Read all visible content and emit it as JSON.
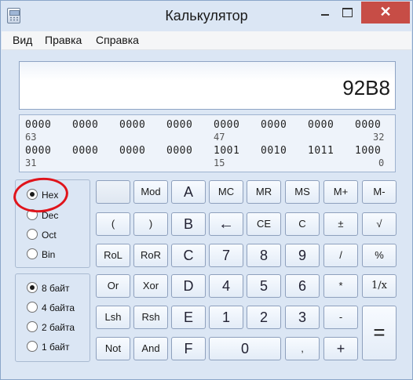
{
  "window": {
    "title": "Калькулятор",
    "close_label": "✕"
  },
  "menu": [
    "Вид",
    "Правка",
    "Справка"
  ],
  "display": {
    "value": "92B8"
  },
  "bits": {
    "row1": [
      "0000",
      "0000",
      "0000",
      "0000",
      "0000",
      "0000",
      "0000",
      "0000"
    ],
    "row1_positions": [
      "63",
      "47",
      "32"
    ],
    "row2": [
      "0000",
      "0000",
      "0000",
      "0000",
      "1001",
      "0010",
      "1011",
      "1000"
    ],
    "row2_positions": [
      "31",
      "15",
      "0"
    ]
  },
  "base_options": [
    {
      "label": "Hex",
      "selected": true
    },
    {
      "label": "Dec",
      "selected": false
    },
    {
      "label": "Oct",
      "selected": false
    },
    {
      "label": "Bin",
      "selected": false
    }
  ],
  "word_options": [
    {
      "label": "8 байт",
      "selected": true
    },
    {
      "label": "4 байта",
      "selected": false
    },
    {
      "label": "2 байта",
      "selected": false
    },
    {
      "label": "1 байт",
      "selected": false
    }
  ],
  "keys": [
    [
      "",
      "Mod",
      "A",
      "MC",
      "MR",
      "MS",
      "M+",
      "M-"
    ],
    [
      "(",
      ")",
      "B",
      "←",
      "CE",
      "C",
      "±",
      "√"
    ],
    [
      "RoL",
      "RoR",
      "C",
      "7",
      "8",
      "9",
      "/",
      "%"
    ],
    [
      "Or",
      "Xor",
      "D",
      "4",
      "5",
      "6",
      "*",
      "1/x"
    ],
    [
      "Lsh",
      "Rsh",
      "E",
      "1",
      "2",
      "3",
      "-",
      "="
    ],
    [
      "Not",
      "And",
      "F",
      "0",
      ",",
      "+"
    ]
  ],
  "annotation": {
    "color": "#e0141b"
  }
}
